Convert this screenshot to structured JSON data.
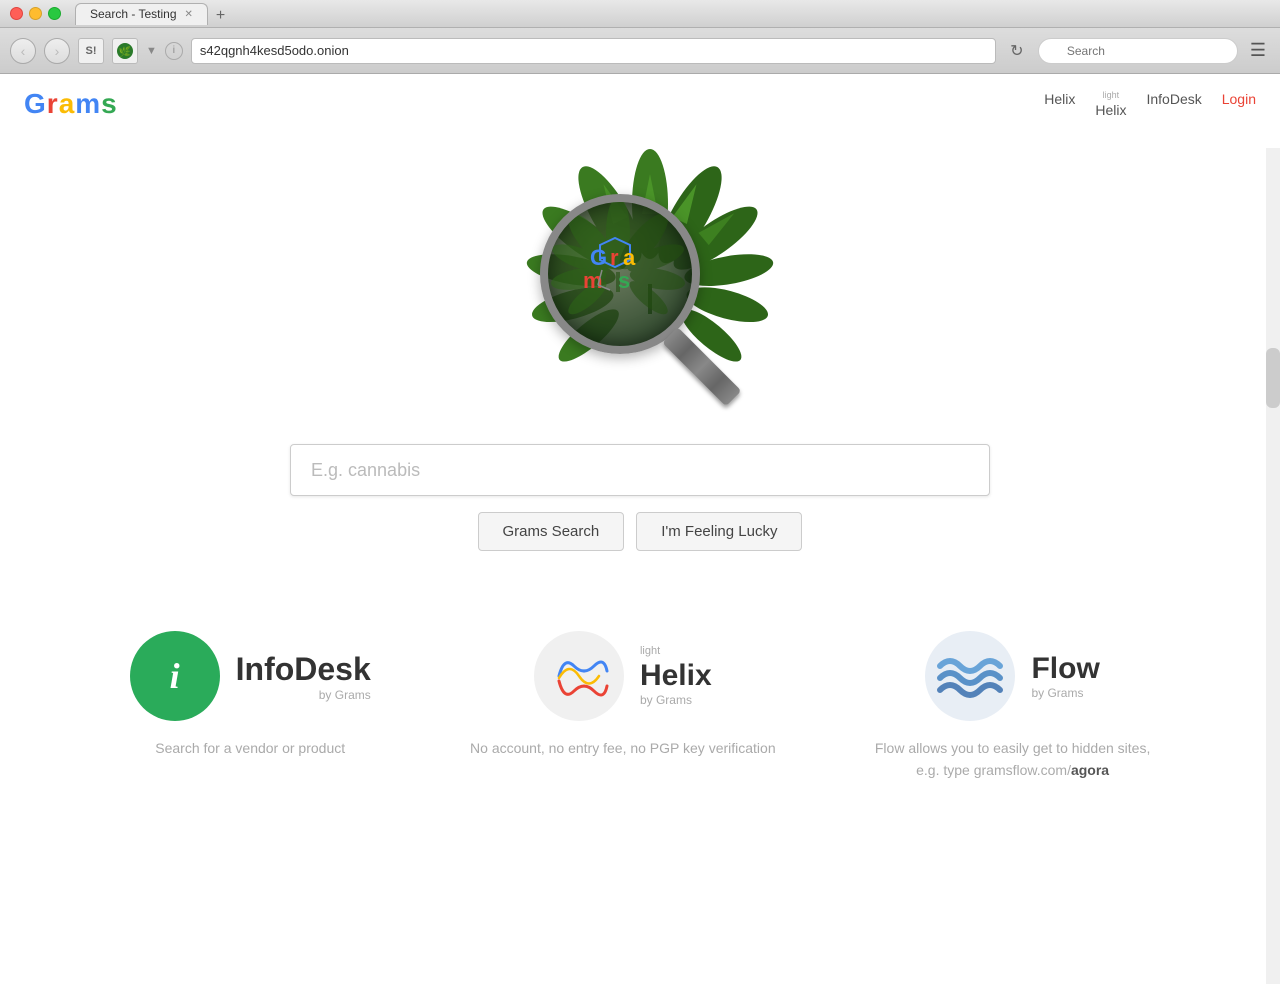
{
  "window": {
    "title": "Search - Testing",
    "url": "s42qgnh4kesd5odo.onion"
  },
  "browser": {
    "search_placeholder": "Search",
    "search_value": ""
  },
  "nav": {
    "helix_label": "Helix",
    "helix_light_label": "Helix",
    "helix_light_superscript": "light",
    "infodesk_label": "InfoDesk",
    "login_label": "Login"
  },
  "logo": {
    "text": "Grams",
    "letters": [
      "G",
      "r",
      "a",
      "m",
      "s"
    ]
  },
  "search": {
    "placeholder": "E.g. cannabis",
    "grams_search_btn": "Grams Search",
    "lucky_btn": "I'm Feeling Lucky"
  },
  "products": [
    {
      "id": "infodesk",
      "icon_letter": "i",
      "name_part1": "Info",
      "name_part2": "Desk",
      "by": "by Grams",
      "desc": "Search for a vendor or product"
    },
    {
      "id": "helix",
      "superscript": "light",
      "name": "Helix",
      "by": "by Grams",
      "desc": "No account, no entry fee, no PGP key verification"
    },
    {
      "id": "flow",
      "name": "Flow",
      "by": "by Grams",
      "desc": "Flow allows you to easily get to hidden sites, e.g. type gramsflow.com/agora",
      "link_text": "agora"
    }
  ]
}
